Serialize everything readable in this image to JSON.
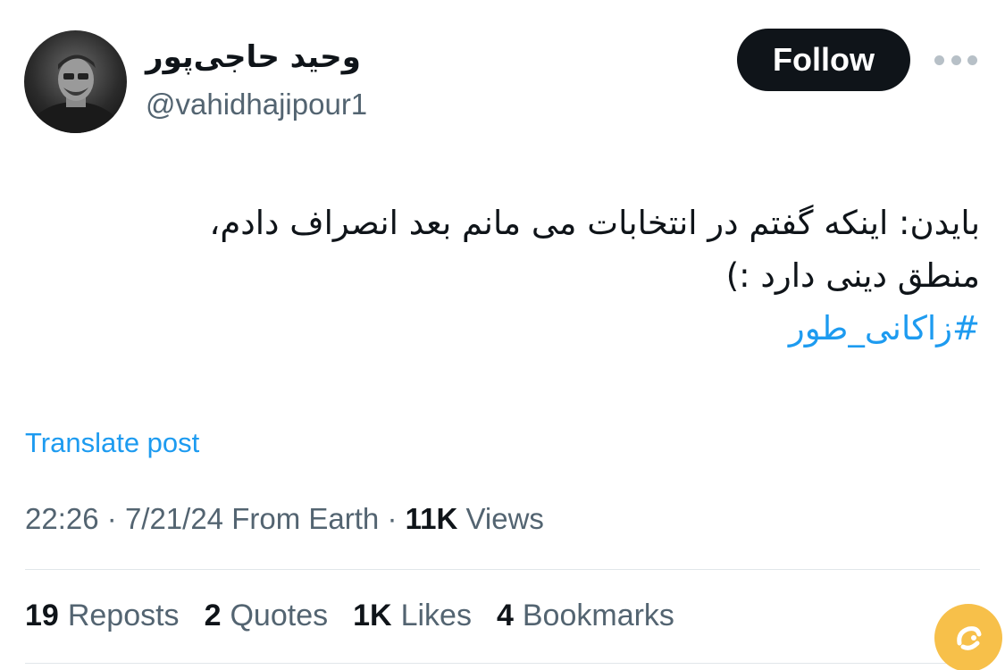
{
  "author": {
    "display_name": "وحید حاجی‌پور",
    "handle": "@vahidhajipour1"
  },
  "actions": {
    "follow_label": "Follow",
    "more_icon": "more-horizontal-icon"
  },
  "post": {
    "line1": "بایدن: اینکه گفتم در انتخابات می مانم بعد انصراف دادم،",
    "line2": "منطق دینی دارد :)",
    "hashtag": "#زاکانی_طور",
    "translate_label": "Translate post"
  },
  "meta": {
    "time": "22:26",
    "date": "7/21/24",
    "source": "From Earth",
    "views_count": "11K",
    "views_label": "Views",
    "separator": "·"
  },
  "stats": [
    {
      "count": "19",
      "label": "Reposts"
    },
    {
      "count": "2",
      "label": "Quotes"
    },
    {
      "count": "1K",
      "label": "Likes"
    },
    {
      "count": "4",
      "label": "Bookmarks"
    }
  ],
  "colors": {
    "text": "#0f1419",
    "secondary": "#536471",
    "link": "#1d9bf0",
    "button_bg": "#0f1419",
    "watermark_bg": "#f7c04a"
  }
}
